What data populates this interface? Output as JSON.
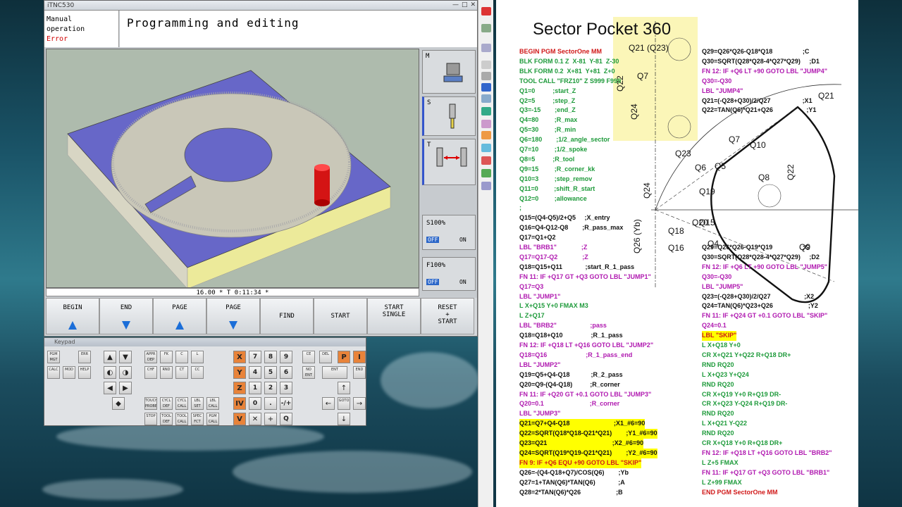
{
  "tnc": {
    "window_title": "iTNC530",
    "mode": {
      "line1": "Manual",
      "line2": "operation",
      "error": "Error"
    },
    "header": "Programming and editing",
    "status_line": "16.00 * T        0:11:34 *",
    "side": {
      "m": "M",
      "s": "S",
      "t": "T"
    },
    "overrides": [
      {
        "label": "S100%",
        "off": "OFF",
        "on": "ON"
      },
      {
        "label": "F100%",
        "off": "OFF",
        "on": "ON"
      }
    ],
    "softkeys": [
      {
        "l1": "BEGIN",
        "l2": "",
        "arrow": "up"
      },
      {
        "l1": "END",
        "l2": "",
        "arrow": "down"
      },
      {
        "l1": "PAGE",
        "l2": "",
        "arrow": "up"
      },
      {
        "l1": "PAGE",
        "l2": "",
        "arrow": "down"
      },
      {
        "l1": "FIND",
        "l2": "",
        "arrow": ""
      },
      {
        "l1": "START",
        "l2": "",
        "arrow": ""
      },
      {
        "l1": "START",
        "l2": "SINGLE",
        "arrow": ""
      },
      {
        "l1": "RESET",
        "l2": "+\nSTART",
        "arrow": ""
      }
    ]
  },
  "keypad": {
    "title": "Keypad",
    "left_keys": [
      "PGM MGT",
      "ERR",
      "CALC",
      "MOD",
      "HELP"
    ],
    "digits": [
      "7",
      "8",
      "9",
      "4",
      "5",
      "6",
      "1",
      "2",
      "3",
      "0",
      ".",
      "-/+"
    ],
    "axes": [
      "X",
      "Y",
      "Z",
      "IV",
      "V",
      "P",
      "I"
    ],
    "misc": [
      "CE",
      "DEL",
      "ENT",
      "END",
      "NO ENT",
      "GOTO",
      "Q"
    ],
    "prog_keys": [
      "APPR DEP",
      "FK",
      "CHF",
      "RND",
      "CT",
      "CC",
      "C",
      "L",
      "TOUCH PROBE",
      "CYCL DEF",
      "CYCL CALL",
      "LBL SET",
      "LBL CALL",
      "STOP",
      "TOOL DEF",
      "TOOL CALL",
      "SPEC FCT",
      "PGM CALL"
    ]
  },
  "document": {
    "title": "Sector Pocket 360",
    "col1": [
      {
        "t": "BEGIN PGM SectorOne MM",
        "c": "red",
        "hl": false
      },
      {
        "t": "BLK FORM 0.1 Z  X-81  Y-81  Z-30",
        "c": "green",
        "hl": false
      },
      {
        "t": "BLK FORM 0.2  X+81  Y+81  Z+0",
        "c": "green",
        "hl": false
      },
      {
        "t": "TOOL CALL \"FRZ10\" Z S999 F999",
        "c": "green",
        "hl": false
      },
      {
        "t": "Q1=0          ;start_Z",
        "c": "green",
        "hl": false
      },
      {
        "t": "Q2=5          ;step_Z",
        "c": "green",
        "hl": false
      },
      {
        "t": "Q3=-15        ;end_Z",
        "c": "green",
        "hl": false
      },
      {
        "t": "Q4=80         ;R_max",
        "c": "green",
        "hl": false
      },
      {
        "t": "Q5=30         ;R_min",
        "c": "green",
        "hl": false
      },
      {
        "t": "Q6=180        ;1/2_angle_sector",
        "c": "green",
        "hl": false
      },
      {
        "t": "Q7=10         ;1/2_spoke",
        "c": "green",
        "hl": false
      },
      {
        "t": "Q8=5          ;R_tool",
        "c": "green",
        "hl": false
      },
      {
        "t": "Q9=15         ;R_corner_kk",
        "c": "green",
        "hl": false
      },
      {
        "t": "Q10=3         ;step_remov",
        "c": "green",
        "hl": false
      },
      {
        "t": "Q11=0         ;shift_R_start",
        "c": "green",
        "hl": false
      },
      {
        "t": "Q12=0         ;allowance",
        "c": "green",
        "hl": false
      },
      {
        "t": ";",
        "c": "green",
        "hl": false
      },
      {
        "t": "Q15=(Q4-Q5)/2+Q5     ;X_entry",
        "c": "black",
        "hl": false
      },
      {
        "t": "Q16=Q4-Q12-Q8        ;R_pass_max",
        "c": "black",
        "hl": false
      },
      {
        "t": "Q17=Q1+Q2",
        "c": "black",
        "hl": false
      },
      {
        "t": "LBL \"BRB1\"              ;Z",
        "c": "purple",
        "hl": false
      },
      {
        "t": "Q17=Q17-Q2              ;Z",
        "c": "purple",
        "hl": false
      },
      {
        "t": "Q18=Q15+Q11             ;start_R_1_pass",
        "c": "black",
        "hl": false
      },
      {
        "t": "FN 11: IF +Q17 GT +Q3 GOTO LBL \"JUMP1\"",
        "c": "purple",
        "hl": false
      },
      {
        "t": "Q17=Q3",
        "c": "purple",
        "hl": false
      },
      {
        "t": "LBL \"JUMP1\"",
        "c": "purple",
        "hl": false
      },
      {
        "t": "L X+Q15 Y+0 FMAX M3",
        "c": "green",
        "hl": false
      },
      {
        "t": "L Z+Q17",
        "c": "green",
        "hl": false
      },
      {
        "t": "LBL \"BRB2\"                   ;pass",
        "c": "purple",
        "hl": false
      },
      {
        "t": "Q18=Q18+Q10                ;R_1_pass",
        "c": "black",
        "hl": false
      },
      {
        "t": "FN 12: IF +Q18 LT +Q16 GOTO LBL \"JUMP2\"",
        "c": "purple",
        "hl": false
      },
      {
        "t": "Q18=Q16                      ;R_1_pass_end",
        "c": "purple",
        "hl": false
      },
      {
        "t": "LBL \"JUMP2\"",
        "c": "purple",
        "hl": false
      },
      {
        "t": "Q19=Q5+Q4-Q18            ;R_2_pass",
        "c": "black",
        "hl": false
      },
      {
        "t": "Q20=Q9-(Q4-Q18)          ;R_corner",
        "c": "black",
        "hl": false
      },
      {
        "t": "FN 11: IF +Q20 GT +0.1 GOTO LBL \"JUMP3\"",
        "c": "purple",
        "hl": false
      },
      {
        "t": "Q20=0.1                          ;R_corner",
        "c": "purple",
        "hl": false
      },
      {
        "t": "LBL \"JUMP3\"",
        "c": "purple",
        "hl": false
      },
      {
        "t": "Q21=Q7+Q4-Q18                         ;X1_#6=90",
        "c": "black",
        "hl": true
      },
      {
        "t": "Q22=SQRT(Q18*Q18-Q21*Q21)        ;Y1_#6=90",
        "c": "black",
        "hl": true
      },
      {
        "t": "Q23=Q21                                     ;X2_#6=90",
        "c": "black",
        "hl": true
      },
      {
        "t": "Q24=SQRT(Q19*Q19-Q21*Q21)        ;Y2_#6=90",
        "c": "black",
        "hl": true
      },
      {
        "t": "FN 9: IF +Q6 EQU +90 GOTO LBL \"SKIP\"",
        "c": "red",
        "hl": true
      },
      {
        "t": "Q26=-(Q4-Q18+Q7)/COS(Q6)        ;Yb",
        "c": "black",
        "hl": false
      },
      {
        "t": "Q27=1+TAN(Q6)*TAN(Q6)             ;A",
        "c": "black",
        "hl": false
      },
      {
        "t": "Q28=2*TAN(Q6)*Q26                    ;B",
        "c": "black",
        "hl": false
      }
    ],
    "col2": [
      {
        "t": "Q29=Q26*Q26-Q18*Q18                 ;C",
        "c": "black",
        "hl": false
      },
      {
        "t": "Q30=SQRT(Q28*Q28-4*Q27*Q29)     ;D1",
        "c": "black",
        "hl": false
      },
      {
        "t": "FN 12: IF +Q6 LT +90 GOTO LBL \"JUMP4\"",
        "c": "purple",
        "hl": false
      },
      {
        "t": "Q30=-Q30",
        "c": "purple",
        "hl": false
      },
      {
        "t": "LBL \"JUMP4\"",
        "c": "purple",
        "hl": false
      },
      {
        "t": "Q21=(-Q28+Q30)/2/Q27                  ;X1",
        "c": "black",
        "hl": false
      },
      {
        "t": "Q22=TAN(Q6)*Q21+Q26                   ;Y1",
        "c": "black",
        "hl": false
      },
      {
        "t": "",
        "c": "black",
        "hl": false
      },
      {
        "t": "",
        "c": "black",
        "hl": false
      },
      {
        "t": "",
        "c": "black",
        "hl": false
      },
      {
        "t": "",
        "c": "black",
        "hl": false
      },
      {
        "t": "",
        "c": "black",
        "hl": false
      },
      {
        "t": "",
        "c": "black",
        "hl": false
      },
      {
        "t": "",
        "c": "black",
        "hl": false
      },
      {
        "t": "",
        "c": "black",
        "hl": false
      },
      {
        "t": "",
        "c": "black",
        "hl": false
      },
      {
        "t": "",
        "c": "black",
        "hl": false
      },
      {
        "t": "",
        "c": "black",
        "hl": false
      },
      {
        "t": "",
        "c": "black",
        "hl": false
      },
      {
        "t": "",
        "c": "black",
        "hl": false
      },
      {
        "t": "Q29=Q26*Q26-Q19*Q19                 ;C",
        "c": "black",
        "hl": false
      },
      {
        "t": "Q30=SQRT(Q28*Q28-4*Q27*Q29)     ;D2",
        "c": "black",
        "hl": false
      },
      {
        "t": "FN 12: IF +Q6 LT +90 GOTO LBL \"JUMP5\"",
        "c": "purple",
        "hl": false
      },
      {
        "t": "Q30=-Q30",
        "c": "purple",
        "hl": false
      },
      {
        "t": "LBL \"JUMP5\"",
        "c": "purple",
        "hl": false
      },
      {
        "t": "Q23=(-Q28+Q30)/2/Q27                   ;X2",
        "c": "black",
        "hl": false
      },
      {
        "t": "Q24=TAN(Q6)*Q23+Q26                    ;Y2",
        "c": "black",
        "hl": false
      },
      {
        "t": "FN 11: IF +Q24 GT +0.1 GOTO LBL \"SKIP\"",
        "c": "purple",
        "hl": false
      },
      {
        "t": "Q24=0.1",
        "c": "purple",
        "hl": false
      },
      {
        "t": "LBL \"SKIP\"",
        "c": "red",
        "hl": true
      },
      {
        "t": "L X+Q18 Y+0",
        "c": "green",
        "hl": false
      },
      {
        "t": "CR X+Q21 Y+Q22 R+Q18 DR+",
        "c": "green",
        "hl": false
      },
      {
        "t": "RND RQ20",
        "c": "green",
        "hl": false
      },
      {
        "t": "L X+Q23 Y+Q24",
        "c": "green",
        "hl": false
      },
      {
        "t": "RND RQ20",
        "c": "green",
        "hl": false
      },
      {
        "t": "CR X+Q19 Y+0 R+Q19 DR-",
        "c": "green",
        "hl": false
      },
      {
        "t": "CR X+Q23 Y-Q24 R+Q19 DR-",
        "c": "green",
        "hl": false
      },
      {
        "t": "RND RQ20",
        "c": "green",
        "hl": false
      },
      {
        "t": "L X+Q21 Y-Q22",
        "c": "green",
        "hl": false
      },
      {
        "t": "RND RQ20",
        "c": "green",
        "hl": false
      },
      {
        "t": "CR X+Q18 Y+0 R+Q18 DR+",
        "c": "green",
        "hl": false
      },
      {
        "t": "FN 12: IF +Q18 LT +Q16 GOTO LBL \"BRB2\"",
        "c": "purple",
        "hl": false
      },
      {
        "t": "L Z+5 FMAX",
        "c": "green",
        "hl": false
      },
      {
        "t": "FN 11: IF +Q17 GT +Q3 GOTO LBL \"BRB1\"",
        "c": "purple",
        "hl": false
      },
      {
        "t": "L Z+99 FMAX",
        "c": "green",
        "hl": false
      },
      {
        "t": "END PGM SectorOne MM",
        "c": "red",
        "hl": false
      }
    ],
    "dimension_labels": [
      "Q21 (Q23)",
      "Q7",
      "Q22",
      "Q24",
      "Q21",
      "Q23",
      "Q6",
      "Q5",
      "Q7",
      "Q10",
      "Q8",
      "Q22",
      "Q24",
      "Q19",
      "Q15",
      "Q26 (Yb)",
      "Q18",
      "Q20",
      "Q16",
      "Q4",
      "Q9"
    ]
  }
}
